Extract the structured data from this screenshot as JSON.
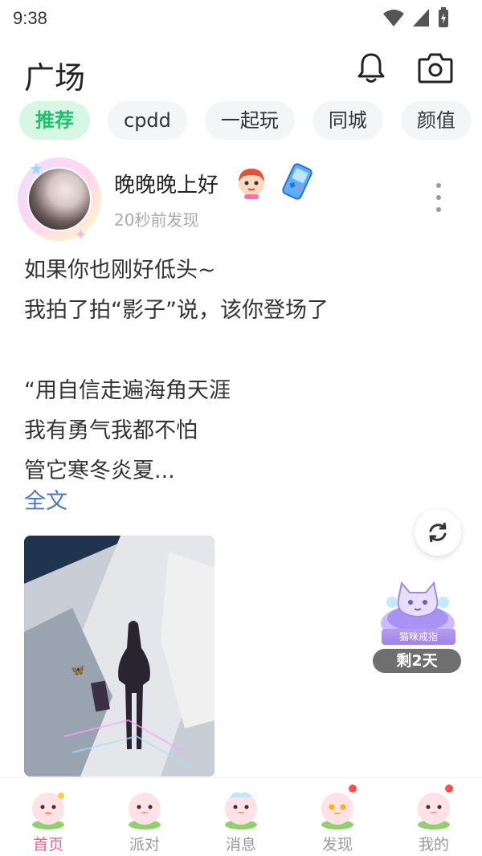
{
  "status_bar": {
    "time": "9:38"
  },
  "header": {
    "title": "广场",
    "icons": [
      "bell-icon",
      "camera-icon"
    ]
  },
  "tabs": [
    {
      "label": "推荐",
      "active": true
    },
    {
      "label": "cpdd",
      "active": false
    },
    {
      "label": "一起玩",
      "active": false
    },
    {
      "label": "同城",
      "active": false
    },
    {
      "label": "颜值",
      "active": false
    }
  ],
  "post": {
    "username": "晚晚晚上好",
    "time": "20秒前发现",
    "lines": [
      "如果你也刚好低头~",
      "我拍了拍“影子”说，该你登场了",
      "",
      "“用自信走遍海角天涯",
      "我有勇气我都不怕",
      "管它寒冬炎夏..."
    ],
    "read_more": "全文"
  },
  "floating": {
    "gift_name": "猫咪戒指",
    "days_left": "剩2天"
  },
  "bottom_nav": [
    {
      "label": "首页",
      "active": true,
      "badge": false
    },
    {
      "label": "派对",
      "active": false,
      "badge": false
    },
    {
      "label": "消息",
      "active": false,
      "badge": false
    },
    {
      "label": "发现",
      "active": false,
      "badge": true
    },
    {
      "label": "我的",
      "active": false,
      "badge": true
    }
  ],
  "colors": {
    "accent_green": "#1fbf6f",
    "accent_pink": "#ff5c8a",
    "link_blue": "#4a78c0"
  }
}
